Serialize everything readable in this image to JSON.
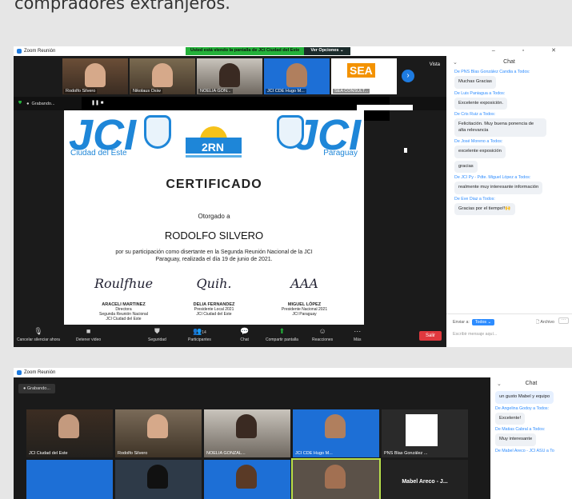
{
  "caption": "compradores extranjeros.",
  "window1": {
    "title": "Zoom Reunión",
    "share_banner": "Usted está viendo la pantalla de JCI Ciudad del Este",
    "view_options": "Ver Opciones ⌄",
    "view_label": "Vista",
    "recording": "Grabando...",
    "participants": [
      {
        "name": "Rodolfo Silvero"
      },
      {
        "name": "Nikolaus Osiw"
      },
      {
        "name": "NOELIA GON..."
      },
      {
        "name": "JCI CDE Hugo M..."
      },
      {
        "name": "SEA CONSULT..."
      }
    ],
    "certificate": {
      "org_left": "Ciudad del Este",
      "org_right": "Paraguay",
      "event_logo": "2RN",
      "title": "CERTIFICADO",
      "granted": "Otorgado a",
      "recipient": "RODOLFO SILVERO",
      "description": "por su participación como disertante en la Segunda Reunión Nacional de la JCI Paraguay, realizada el día 19 de junio de 2021.",
      "signatures": [
        {
          "name": "ARACELI MARTINEZ",
          "role": "Directora",
          "line2": "Segunda Reunión Nacional",
          "line3": "JCI Ciudad del Este"
        },
        {
          "name": "DELIA FERNANDEZ",
          "role": "Presidente Local 2021",
          "line2": "JCI Ciudad del Este",
          "line3": ""
        },
        {
          "name": "MIGUEL LÓPEZ",
          "role": "Presidente Nacional 2021",
          "line2": "JCI Paraguay",
          "line3": ""
        }
      ]
    },
    "toolbar": {
      "mute": "Cancelar silenciar ahora",
      "video": "Detener video",
      "security": "Seguridad",
      "participants": "Participantes",
      "participants_count": "14",
      "chat": "Chat",
      "share": "Compartir pantalla",
      "reactions": "Reacciones",
      "more": "Más",
      "leave": "Salir"
    },
    "chat": {
      "title": "Chat",
      "messages": [
        {
          "from": "De PNS Blas González Candia a Todos:",
          "text": "Muchas Gracias"
        },
        {
          "from": "De Luis Paniagua a Todos:",
          "text": "Excelente exposición."
        },
        {
          "from": "De Cris Ruiz a Todos:",
          "text": "Felicitación. Muy buena ponencia de alta relevancia"
        },
        {
          "from": "De José Moreno a Todos:",
          "text": "excelente exposición"
        },
        {
          "from": "",
          "text": "gracias"
        },
        {
          "from": "De JCI Py - Pdte. Miguel López a Todos:",
          "text": "realmente muy interesante información"
        },
        {
          "from": "De Eve Diaz a Todos:",
          "text": "Gracias por el tiempo!!🙌"
        }
      ],
      "send_to_label": "Enviar a:",
      "send_to": "Todos ⌄",
      "file": "Archivo",
      "placeholder": "Escribir mensaje aquí..."
    }
  },
  "window2": {
    "title": "Zoom Reunión",
    "recording": "Grabando...",
    "tiles": [
      {
        "name": "JCI Ciudad del Este"
      },
      {
        "name": "Rodolfo Silvero"
      },
      {
        "name": "NOELIA GONZAL..."
      },
      {
        "name": "JCI CDE Hugo M..."
      },
      {
        "name": "PNS Blas González ..."
      },
      {
        "name": ""
      },
      {
        "name": ""
      },
      {
        "name": ""
      },
      {
        "name": ""
      },
      {
        "name": "Mabel Areco - J..."
      }
    ],
    "chat": {
      "title": "Chat",
      "messages": [
        {
          "from": "",
          "text": "un gusto Mabel y equipo"
        },
        {
          "from": "De Angelina Godoy a Todos:",
          "text": "Excelente!"
        },
        {
          "from": "De Matias Cabral a Todos:",
          "text": "Muy interesante"
        },
        {
          "from": "De Mabel Areco - JCI ASU a To",
          "text": ""
        }
      ]
    }
  }
}
